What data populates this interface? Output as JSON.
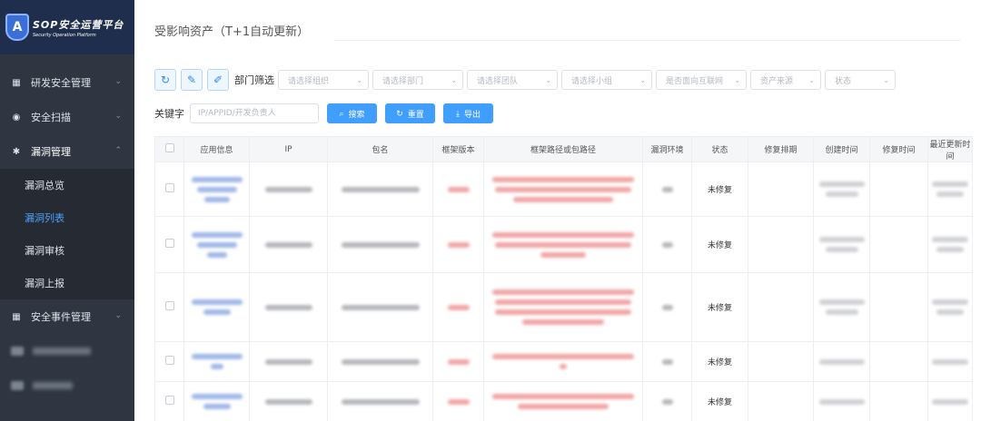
{
  "logo": {
    "title": "SOP安全运营平台",
    "subtitle": "Security Operation Platform",
    "badge": "A"
  },
  "sidebar": {
    "items": [
      {
        "label": "研发安全管理"
      },
      {
        "label": "安全扫描"
      },
      {
        "label": "漏洞管理"
      },
      {
        "label": "安全事件管理"
      }
    ],
    "sub_items": [
      {
        "label": "漏洞总览"
      },
      {
        "label": "漏洞列表"
      },
      {
        "label": "漏洞审核"
      },
      {
        "label": "漏洞上报"
      }
    ]
  },
  "page": {
    "title": "受影响资产（T+1自动更新）"
  },
  "filters": {
    "label": "部门筛选",
    "selects": [
      {
        "placeholder": "请选择组织"
      },
      {
        "placeholder": "请选择部门"
      },
      {
        "placeholder": "请选择团队"
      },
      {
        "placeholder": "请选择小组"
      },
      {
        "placeholder": "是否面向互联网"
      },
      {
        "placeholder": "资产来源"
      },
      {
        "placeholder": "状态"
      }
    ]
  },
  "search": {
    "label": "关键字",
    "placeholder": "IP/APPID/开发负责人",
    "search_button": "搜索",
    "reset_button": "重置",
    "export_button": "导出"
  },
  "table": {
    "headers": [
      "应用信息",
      "IP",
      "包名",
      "框架版本",
      "框架路径或包路径",
      "漏洞环境",
      "状态",
      "修复排期",
      "创建时间",
      "修复时间",
      "最近更新时间"
    ],
    "rows": [
      {
        "status": "未修复"
      },
      {
        "status": "未修复"
      },
      {
        "status": "未修复"
      },
      {
        "status": "未修复"
      },
      {
        "status": "未修复"
      }
    ]
  },
  "colors": {
    "accent": "#409eff",
    "sidebar_bg": "#2f3641",
    "active_menu": "#4ea0ff"
  }
}
